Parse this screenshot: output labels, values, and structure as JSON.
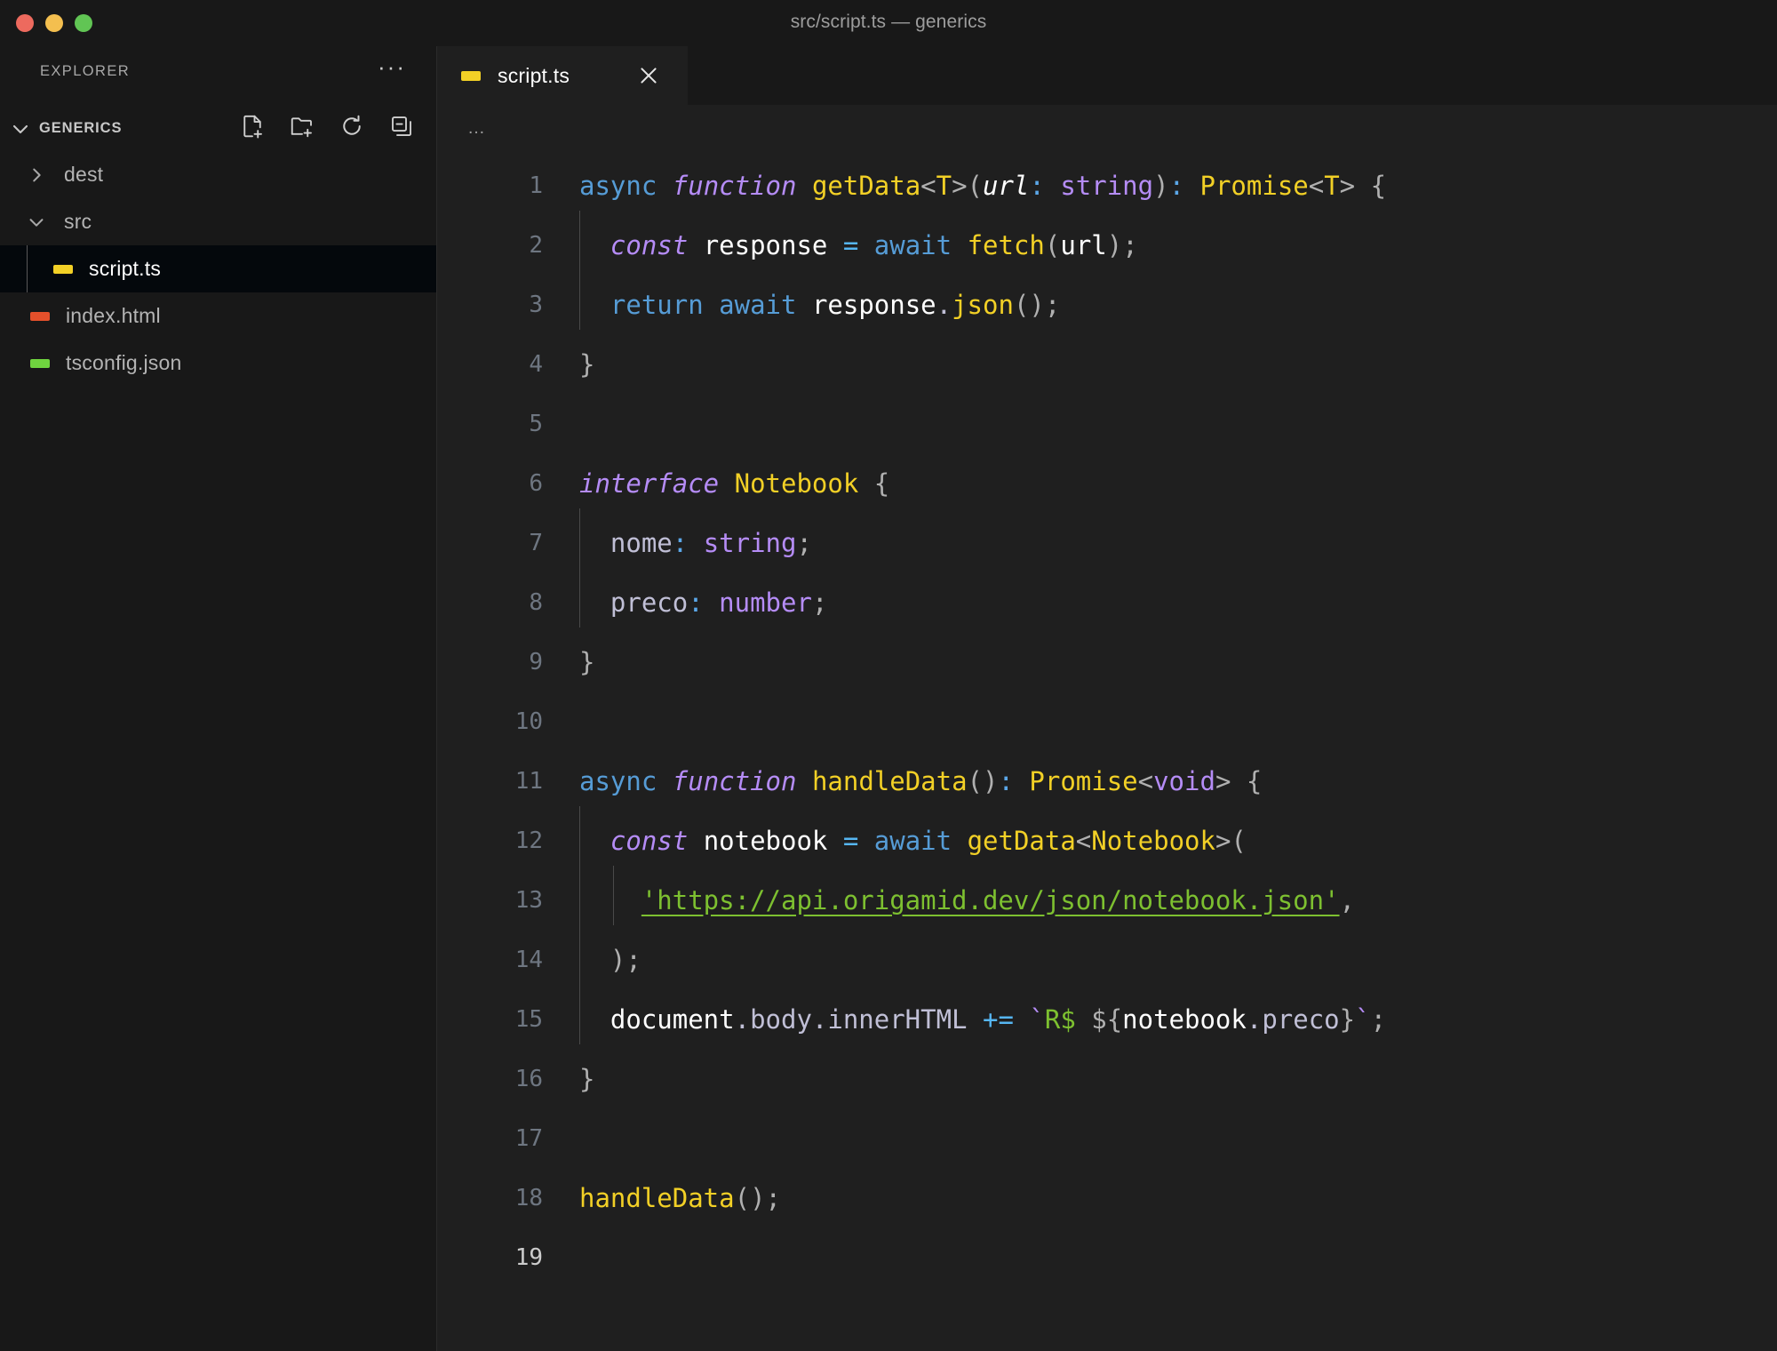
{
  "window": {
    "title": "src/script.ts — generics",
    "traffic_lights": [
      "close",
      "minimize",
      "maximize"
    ]
  },
  "sidebar": {
    "explorer_label": "EXPLORER",
    "more_actions_label": "···",
    "project": {
      "name": "GENERICS",
      "expanded": true,
      "actions": [
        "new-file",
        "new-folder",
        "refresh",
        "collapse-all"
      ]
    },
    "tree": [
      {
        "label": "dest",
        "type": "folder",
        "expanded": false,
        "depth": 1,
        "selected": false
      },
      {
        "label": "src",
        "type": "folder",
        "expanded": true,
        "depth": 1,
        "selected": false
      },
      {
        "label": "script.ts",
        "type": "file",
        "tag_color": "#f2d026",
        "depth": 2,
        "selected": true
      },
      {
        "label": "index.html",
        "type": "file",
        "tag_color": "#e4502b",
        "depth": 1,
        "selected": false
      },
      {
        "label": "tsconfig.json",
        "type": "file",
        "tag_color": "#6fd43f",
        "depth": 1,
        "selected": false
      }
    ]
  },
  "editor": {
    "tabs": [
      {
        "label": "script.ts",
        "tag_color": "#f2d026",
        "active": true,
        "close_label": "✕"
      }
    ],
    "breadcrumb": "…",
    "active_line": 19,
    "lines": [
      {
        "n": "1",
        "text": "async function getData<T>(url: string): Promise<T> {"
      },
      {
        "n": "2",
        "text": "  const response = await fetch(url);"
      },
      {
        "n": "3",
        "text": "  return await response.json();"
      },
      {
        "n": "4",
        "text": "}"
      },
      {
        "n": "5",
        "text": ""
      },
      {
        "n": "6",
        "text": "interface Notebook {"
      },
      {
        "n": "7",
        "text": "  nome: string;"
      },
      {
        "n": "8",
        "text": "  preco: number;"
      },
      {
        "n": "9",
        "text": "}"
      },
      {
        "n": "10",
        "text": ""
      },
      {
        "n": "11",
        "text": "async function handleData(): Promise<void> {"
      },
      {
        "n": "12",
        "text": "  const notebook = await getData<Notebook>("
      },
      {
        "n": "13",
        "text": "    'https://api.origamid.dev/json/notebook.json',"
      },
      {
        "n": "14",
        "text": "  );"
      },
      {
        "n": "15",
        "text": "  document.body.innerHTML += `R$ ${notebook.preco}`;"
      },
      {
        "n": "16",
        "text": "}"
      },
      {
        "n": "17",
        "text": ""
      },
      {
        "n": "18",
        "text": "handleData();"
      },
      {
        "n": "19",
        "text": ""
      }
    ]
  },
  "colors": {
    "editor_bg": "#1f1f1f",
    "sidebar_bg": "#181818",
    "selected_row_bg": "#04080c",
    "keyword": "#569CD6",
    "storage": "#B58CF6",
    "function": "#F2D026",
    "type": "#B58CF6",
    "string": "#7DC030",
    "punctuation": "#B0B0B0",
    "line_number": "#6e7681"
  }
}
